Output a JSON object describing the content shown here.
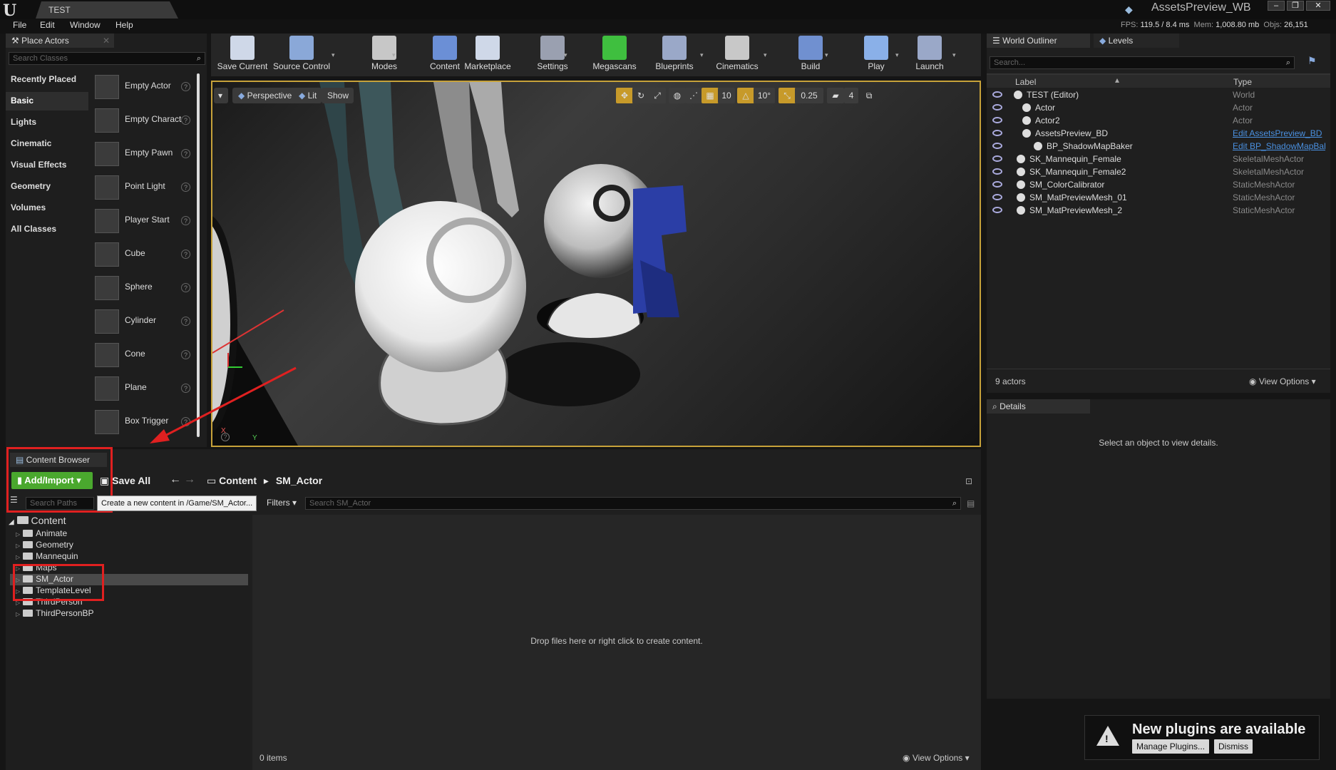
{
  "titlebar": {
    "tab": "TEST",
    "project": "AssetsPreview_WB",
    "minimize": "–",
    "restore": "❐",
    "close": "✕"
  },
  "menu": [
    "File",
    "Edit",
    "Window",
    "Help"
  ],
  "stats": {
    "fps_label": "FPS:",
    "fps": "119.5",
    "ms": "/ 8.4 ms",
    "mem_label": "Mem:",
    "mem": "1,008.80 mb",
    "objs_label": "Objs:",
    "objs": "26,151"
  },
  "place_actors": {
    "title": "Place Actors",
    "search_placeholder": "Search Classes",
    "categories": [
      "Recently Placed",
      "Basic",
      "Lights",
      "Cinematic",
      "Visual Effects",
      "Geometry",
      "Volumes",
      "All Classes"
    ],
    "selected_category": "Basic",
    "items": [
      "Empty Actor",
      "Empty Character",
      "Empty Pawn",
      "Point Light",
      "Player Start",
      "Cube",
      "Sphere",
      "Cylinder",
      "Cone",
      "Plane",
      "Box Trigger"
    ]
  },
  "toolbar": {
    "buttons": [
      "Save Current",
      "Source Control",
      "Modes",
      "Content",
      "Marketplace",
      "Settings",
      "Megascans",
      "Blueprints",
      "Cinematics",
      "Build",
      "Play",
      "Launch"
    ]
  },
  "viewport": {
    "perspective": "Perspective",
    "lit": "Lit",
    "show": "Show",
    "grid_snap": "10",
    "rot_snap": "10°",
    "scale_snap": "0.25",
    "cam_speed": "4",
    "axis_x": "X",
    "axis_y": "Y"
  },
  "outliner": {
    "title": "World Outliner",
    "levels_tab": "Levels",
    "search_placeholder": "Search...",
    "col_label": "Label",
    "col_type": "Type",
    "rows": [
      {
        "label": "TEST (Editor)",
        "type": "World"
      },
      {
        "label": "Actor",
        "type": "Actor"
      },
      {
        "label": "Actor2",
        "type": "Actor"
      },
      {
        "label": "AssetsPreview_BD",
        "type": "Edit AssetsPreview_BD"
      },
      {
        "label": "BP_ShadowMapBaker",
        "type": "Edit BP_ShadowMapBaker"
      },
      {
        "label": "SK_Mannequin_Female",
        "type": "SkeletalMeshActor"
      },
      {
        "label": "SK_Mannequin_Female2",
        "type": "SkeletalMeshActor"
      },
      {
        "label": "SM_ColorCalibrator",
        "type": "StaticMeshActor"
      },
      {
        "label": "SM_MatPreviewMesh_01",
        "type": "StaticMeshActor"
      },
      {
        "label": "SM_MatPreviewMesh_2",
        "type": "StaticMeshActor"
      }
    ],
    "actor_count": "9 actors",
    "view_options": "View Options"
  },
  "details": {
    "title": "Details",
    "empty_text": "Select an object to view details."
  },
  "content_browser": {
    "title": "Content Browser",
    "add_import": "Add/Import",
    "save_all": "Save All",
    "breadcrumb_root": "Content",
    "breadcrumb_current": "SM_Actor",
    "tooltip": "Create a new content in /Game/SM_Actor...",
    "search_paths_placeholder": "Search Paths",
    "filters": "Filters",
    "search_placeholder": "Search SM_Actor",
    "tree_root": "Content",
    "folders": [
      "Animate",
      "Geometry",
      "Mannequin",
      "Maps",
      "SM_Actor",
      "TemplateLevel",
      "ThirdPerson",
      "ThirdPersonBP"
    ],
    "selected_folder": "SM_Actor",
    "empty_text": "Drop files here or right click to create content.",
    "item_count": "0 items",
    "view_options": "View Options"
  },
  "notification": {
    "title": "New plugins are available",
    "manage": "Manage Plugins...",
    "dismiss": "Dismiss"
  },
  "colors": {
    "accent_gold": "#c7a23a",
    "add_green": "#4aa82e",
    "highlight_red": "#e02020",
    "link_blue": "#4a90e0"
  }
}
